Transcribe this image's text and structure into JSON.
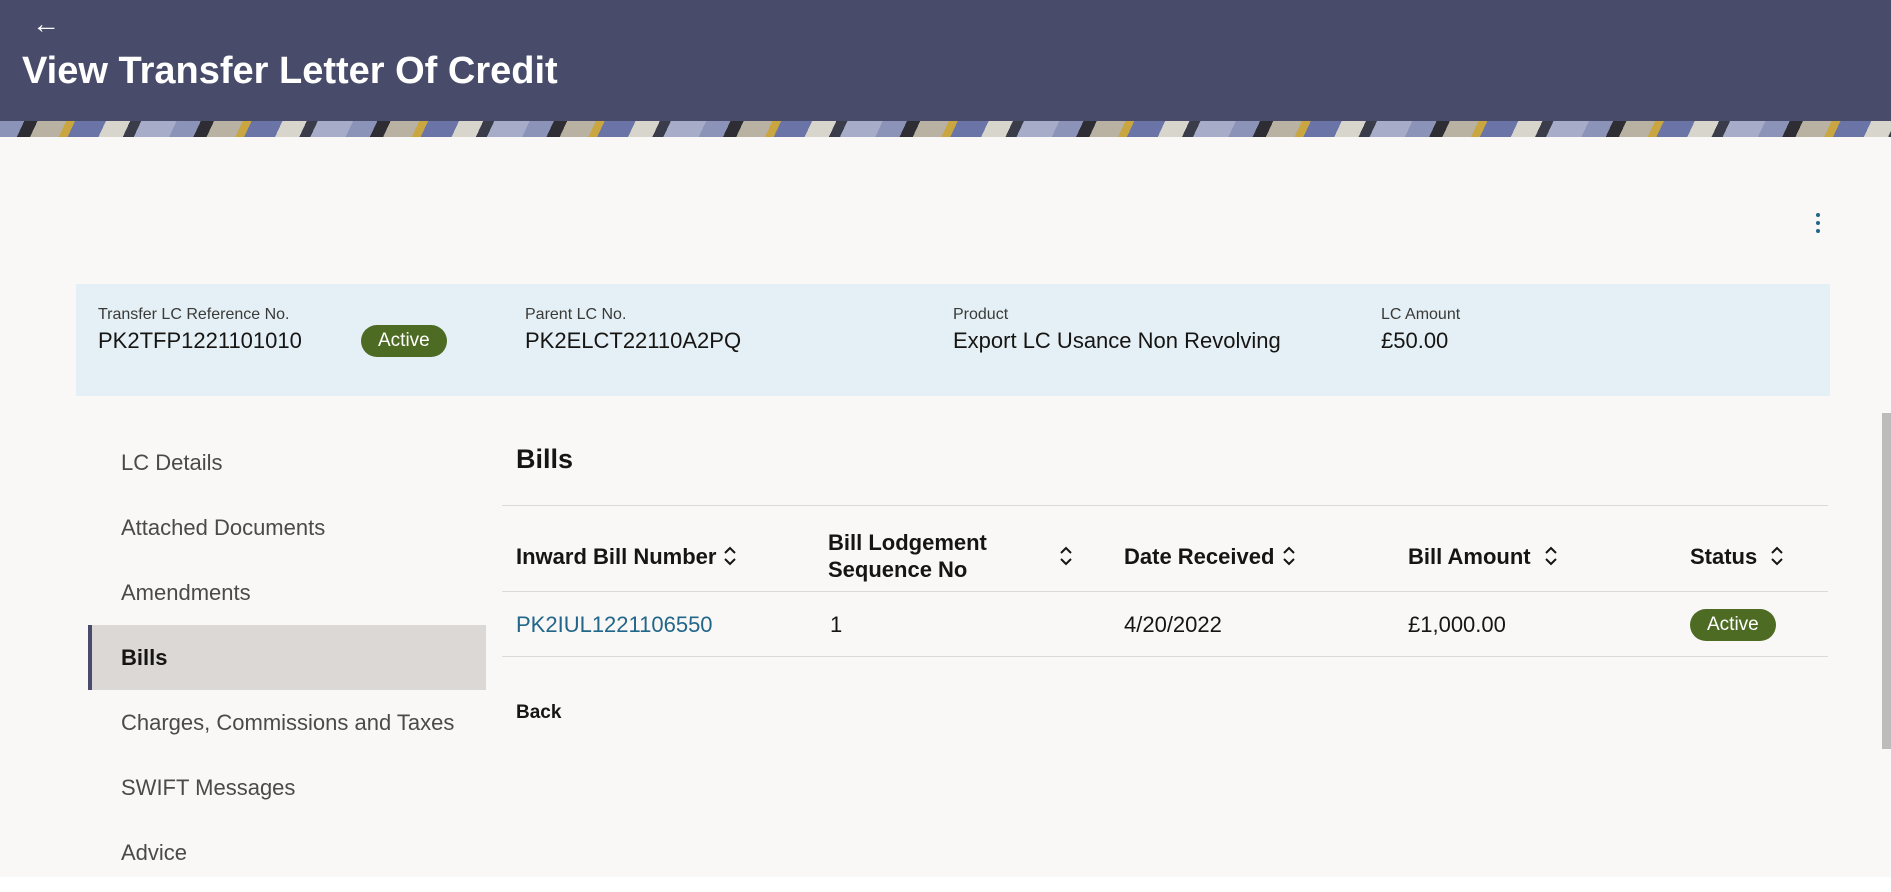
{
  "header": {
    "back_icon": "back-arrow-icon",
    "back_glyph": "←",
    "title": "View Transfer Letter Of Credit"
  },
  "summary": {
    "reference_label": "Transfer LC Reference No.",
    "reference_value": "PK2TFP1221101010",
    "status": "Active",
    "parent_label": "Parent LC No.",
    "parent_value": "PK2ELCT22110A2PQ",
    "product_label": "Product",
    "product_value": "Export LC Usance Non Revolving",
    "amount_label": "LC Amount",
    "amount_value": "£50.00"
  },
  "sidebar": {
    "items": [
      {
        "label": "LC Details"
      },
      {
        "label": "Attached Documents"
      },
      {
        "label": "Amendments"
      },
      {
        "label": "Bills"
      },
      {
        "label": "Charges, Commissions and Taxes"
      },
      {
        "label": "SWIFT Messages"
      },
      {
        "label": "Advice"
      }
    ],
    "active": "Bills"
  },
  "bills": {
    "title": "Bills",
    "columns": {
      "bill_number": "Inward Bill Number",
      "lodgement_line1": "Bill Lodgement",
      "lodgement_line2": "Sequence No",
      "date_received": "Date Received",
      "bill_amount": "Bill Amount",
      "status": "Status"
    },
    "rows": [
      {
        "bill_number": "PK2IUL1221106550",
        "lodgement_seq": "1",
        "date_received": "4/20/2022",
        "bill_amount": "£1,000.00",
        "status": "Active"
      }
    ],
    "back_label": "Back"
  },
  "colors": {
    "header_bg": "#484c6a",
    "summary_bg": "#e4f0f5",
    "badge_bg": "#4e6b24",
    "link": "#22668a",
    "active_nav_bg": "#dcd8d6"
  }
}
